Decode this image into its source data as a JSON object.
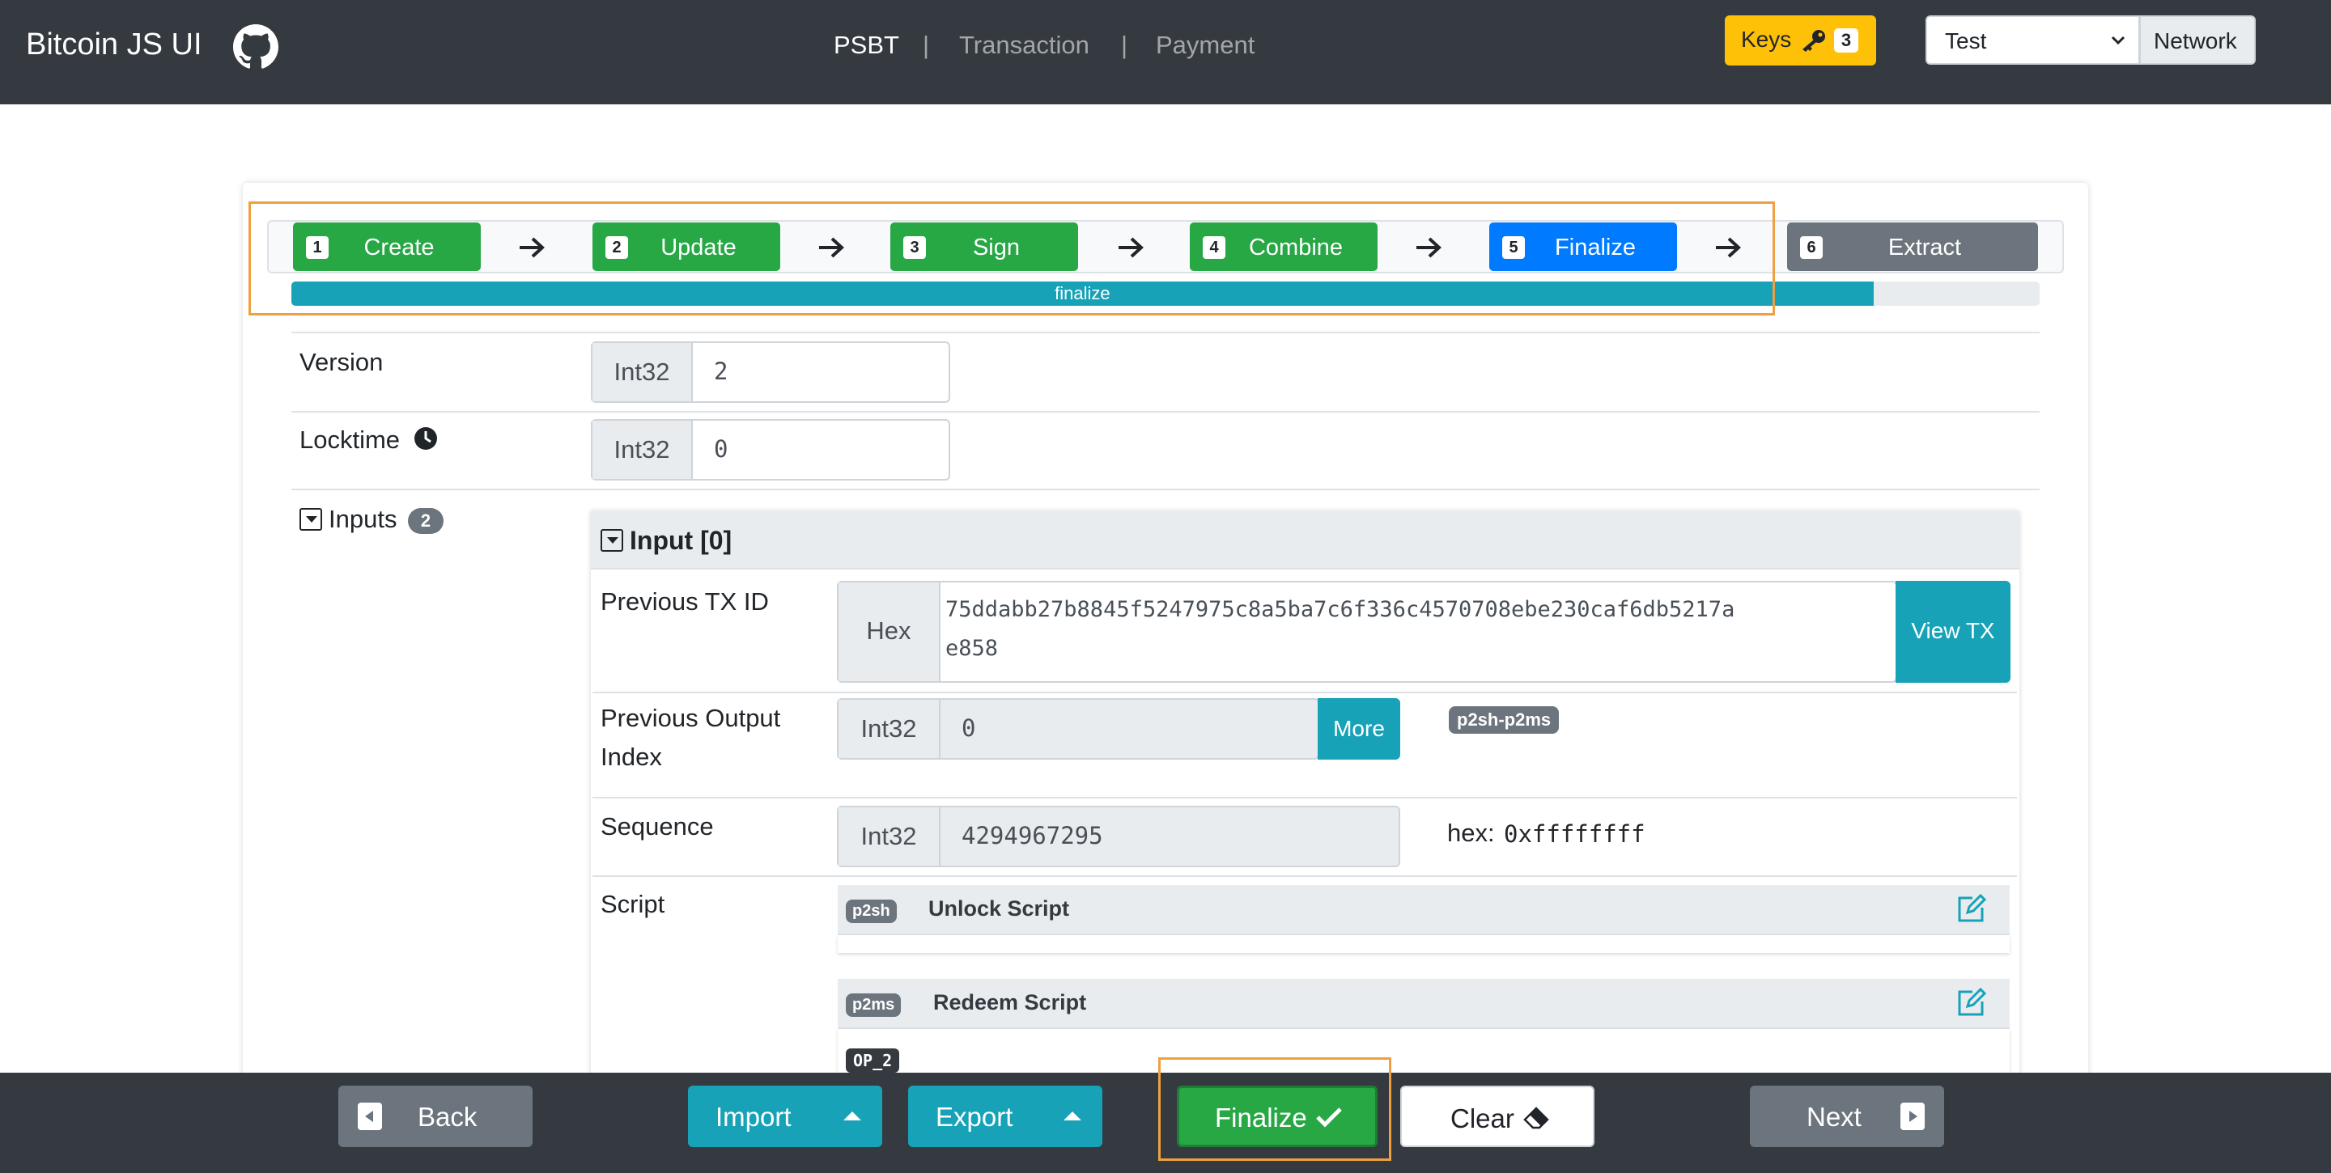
{
  "nav": {
    "brand": "Bitcoin JS UI",
    "github_icon": "github-icon",
    "menu": [
      "PSBT",
      "Transaction",
      "Payment"
    ],
    "separator": "|",
    "keys_label": "Keys",
    "keys_count": "3",
    "network_value": "Test",
    "network_label": "Network"
  },
  "steps": [
    {
      "num": "1",
      "label": "Create",
      "color": "#28a745"
    },
    {
      "num": "2",
      "label": "Update",
      "color": "#28a745"
    },
    {
      "num": "3",
      "label": "Sign",
      "color": "#28a745"
    },
    {
      "num": "4",
      "label": "Combine",
      "color": "#28a745"
    },
    {
      "num": "5",
      "label": "Finalize",
      "color": "#007bff"
    },
    {
      "num": "6",
      "label": "Extract",
      "color": "#6c757d"
    }
  ],
  "progress": {
    "label": "finalize",
    "fraction": 0.905
  },
  "fields": {
    "version_label": "Version",
    "version_prefix": "Int32",
    "version_value": "2",
    "locktime_label": "Locktime",
    "locktime_prefix": "Int32",
    "locktime_value": "0",
    "inputs_label": "Inputs",
    "inputs_count": "2"
  },
  "input0": {
    "title": "Input [0]",
    "prev_txid_label": "Previous TX ID",
    "prev_txid_prefix": "Hex",
    "prev_txid_line1": "75ddabb27b8845f5247975c8a5ba7c6f336c4570708ebe230caf6db5217a",
    "prev_txid_line2": "e858",
    "view_tx": "View TX",
    "prev_out_label_1": "Previous Output",
    "prev_out_label_2": "Index",
    "prev_out_prefix": "Int32",
    "prev_out_value": "0",
    "more": "More",
    "type_badge": "p2sh-p2ms",
    "sequence_label": "Sequence",
    "sequence_prefix": "Int32",
    "sequence_value": "4294967295",
    "hex_label": "hex:",
    "hex_value": "0xffffffff",
    "script_label": "Script",
    "unlock_badge": "p2sh",
    "unlock_title": "Unlock Script",
    "redeem_badge": "p2ms",
    "redeem_title": "Redeem Script",
    "op_badge": "OP_2"
  },
  "bottom": {
    "back": "Back",
    "import": "Import",
    "export": "Export",
    "finalize": "Finalize",
    "clear": "Clear",
    "next": "Next"
  },
  "colors": {
    "accent_success": "#28a745",
    "accent_primary": "#007bff",
    "accent_info": "#17a2b8",
    "accent_warning": "#ffc107",
    "highlight_outline": "#f0a040"
  }
}
